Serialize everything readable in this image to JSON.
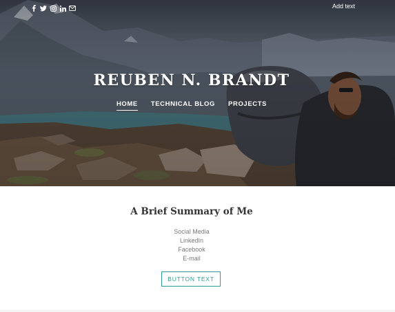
{
  "header": {
    "social_icons": [
      "facebook-icon",
      "twitter-icon",
      "instagram-icon",
      "linkedin-icon",
      "mail-icon"
    ],
    "add_text": "Add text"
  },
  "site": {
    "title": "REUBEN N. BRANDT"
  },
  "nav": {
    "items": [
      {
        "label": "HOME",
        "active": true
      },
      {
        "label": "TECHNICAL BLOG",
        "active": false
      },
      {
        "label": "PROJECTS",
        "active": false
      }
    ]
  },
  "content": {
    "heading": "A Brief Summary of Me",
    "lines": [
      "Social Media",
      "LinkedIn",
      "Facebook",
      "E-mail"
    ],
    "button_label": "BUTTON TEXT"
  },
  "colors": {
    "accent": "#2b9c96",
    "heading": "#333333",
    "muted_text": "#7a7a7a"
  }
}
